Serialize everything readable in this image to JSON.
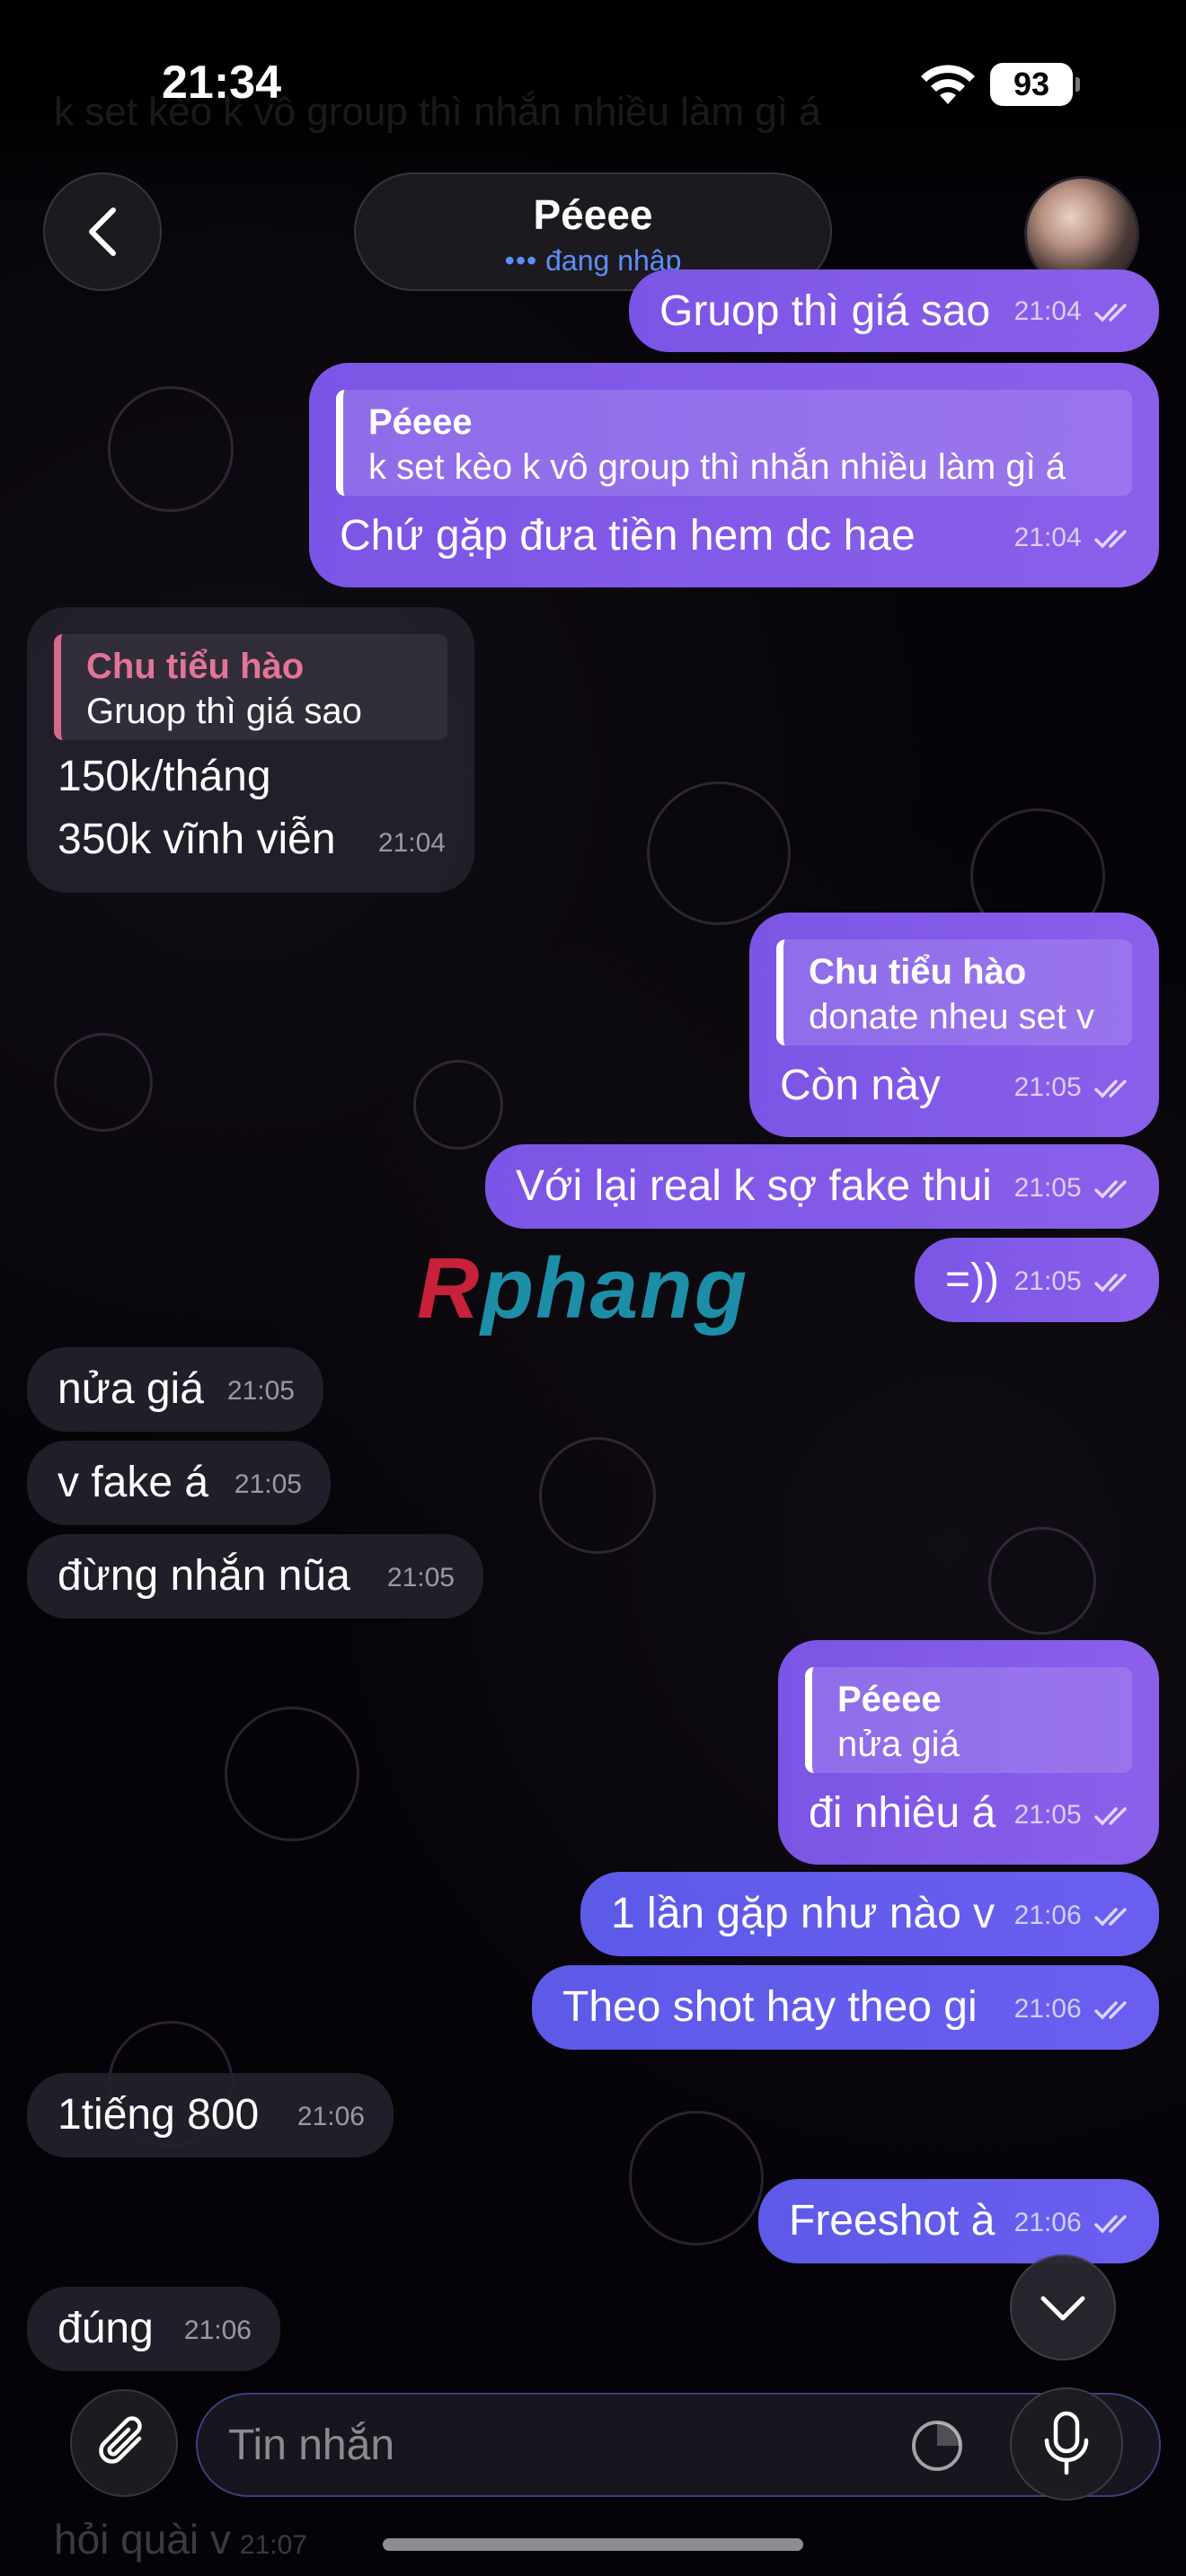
{
  "status_bar": {
    "time": "21:34",
    "battery": "93"
  },
  "header": {
    "contact_name": "Péeee",
    "status_dots": "•••",
    "status_text": "đang nhập"
  },
  "top_peek": {
    "text": "k set kèo k vô group thì nhắn nhiều làm gì á"
  },
  "messages": [
    {
      "text": "Gruop thì giá sao",
      "time": "21:04"
    },
    {
      "reply_author": "Péeee",
      "reply_text": "k set kèo k vô group thì nhắn nhiều làm gì á",
      "text": "Chứ gặp đưa tiền hem dc hae",
      "time": "21:04"
    },
    {
      "reply_author": "Chu tiểu hào",
      "reply_text": "Gruop thì giá sao",
      "text_line1": "150k/tháng",
      "text_line2": "350k vĩnh viễn",
      "time": "21:04"
    },
    {
      "reply_author": "Chu tiểu hào",
      "reply_text": "donate nheu set v",
      "text": "Còn này",
      "time": "21:05"
    },
    {
      "text": "Với lại real k sợ fake thui",
      "time": "21:05"
    },
    {
      "text": "=))",
      "time": "21:05"
    },
    {
      "text": "nửa giá",
      "time": "21:05"
    },
    {
      "text": "v fake á",
      "time": "21:05"
    },
    {
      "text": "đừng nhắn nũa",
      "time": "21:05"
    },
    {
      "reply_author": "Péeee",
      "reply_text": "nửa giá",
      "text": "đi nhiêu á",
      "time": "21:05"
    },
    {
      "text": "1 lần gặp như nào v",
      "time": "21:06"
    },
    {
      "text": "Theo shot hay theo gi",
      "time": "21:06"
    },
    {
      "text": "1tiếng 800",
      "time": "21:06"
    },
    {
      "text": "Freeshot à",
      "time": "21:06"
    },
    {
      "text": "đúng",
      "time": "21:06"
    }
  ],
  "peek_bottom": {
    "text": "hỏi quài v",
    "time": "21:07"
  },
  "watermark": {
    "first": "R",
    "rest": "phang"
  },
  "composer": {
    "placeholder": "Tin nhắn"
  },
  "colors": {
    "outgoing_bubble": "#7c55e6",
    "outgoing_bubble_blue": "#5d5ae8",
    "incoming_bubble": "#24202c",
    "reply_author_incoming": "#e27497",
    "status_typing": "#5b8ff5"
  }
}
